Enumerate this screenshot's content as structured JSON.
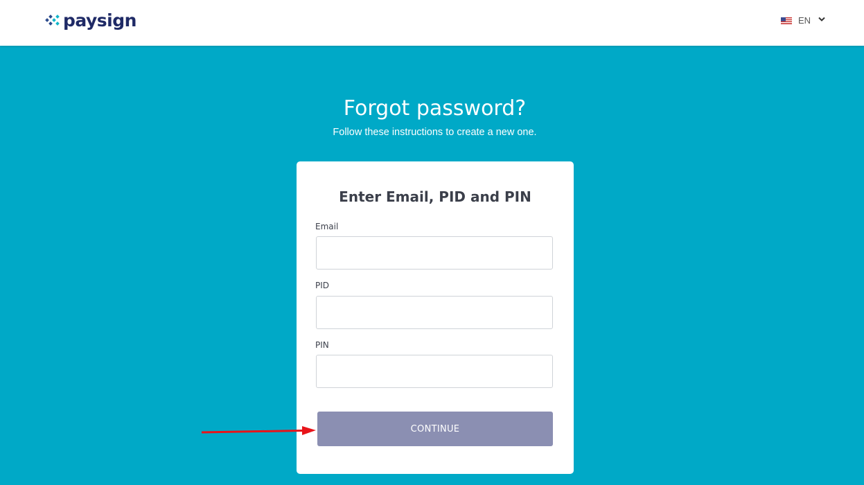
{
  "brand": {
    "name": "paysign",
    "text_color": "#1f2a66",
    "mark_colors": [
      "#2a4a8c",
      "#12b5c9"
    ]
  },
  "language": {
    "flag_icon": "us-flag-icon",
    "code": "EN",
    "dropdown_icon": "chevron-down-icon"
  },
  "hero": {
    "title": "Forgot password?",
    "subtitle": "Follow these instructions to create a new one."
  },
  "form": {
    "title": "Enter Email, PID and PIN",
    "email": {
      "label": "Email",
      "value": "",
      "placeholder": ""
    },
    "pid": {
      "label": "PID",
      "value": "",
      "placeholder": ""
    },
    "pin": {
      "label": "PIN",
      "value": "",
      "placeholder": ""
    },
    "continue_label": "CONTINUE"
  },
  "annotation": {
    "icon": "red-arrow-icon",
    "color": "#e8141a"
  },
  "colors": {
    "background": "#00a9c7",
    "button": "#8b8fb2",
    "card": "#ffffff"
  }
}
